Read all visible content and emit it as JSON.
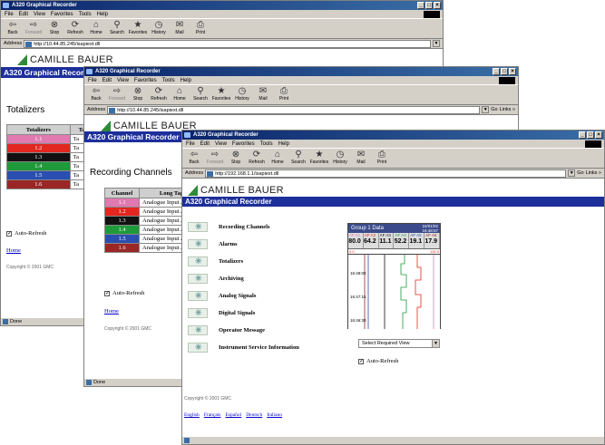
{
  "app": {
    "window_title": "A320 Graphical Recorder",
    "menus": [
      "File",
      "Edit",
      "View",
      "Favorites",
      "Tools",
      "Help"
    ],
    "toolbar": [
      {
        "label": "Back",
        "icon": "back-arrow-icon",
        "glyph": "⇦"
      },
      {
        "label": "Forward",
        "icon": "forward-arrow-icon",
        "glyph": "⇨",
        "disabled": true
      },
      {
        "label": "Stop",
        "icon": "stop-icon",
        "glyph": "⊗"
      },
      {
        "label": "Refresh",
        "icon": "refresh-icon",
        "glyph": "⟳"
      },
      {
        "label": "Home",
        "icon": "home-icon",
        "glyph": "⌂"
      },
      {
        "label": "Search",
        "icon": "search-icon",
        "glyph": "⚲"
      },
      {
        "label": "Favorites",
        "icon": "favorites-icon",
        "glyph": "★"
      },
      {
        "label": "History",
        "icon": "history-icon",
        "glyph": "◷"
      },
      {
        "label": "Mail",
        "icon": "mail-icon",
        "glyph": "✉"
      },
      {
        "label": "Print",
        "icon": "print-icon",
        "glyph": "⎙"
      }
    ],
    "address_label": "Address",
    "go_label": "Go",
    "links_label": "Links »",
    "status_done": "Done"
  },
  "windows": {
    "w1": {
      "url": "http://10.44.85.245/isapiext.dll",
      "brand": "CAMILLE BAUER",
      "banner": "A320 Graphical Recorder",
      "heading": "Totalizers",
      "col1": "Totalizers",
      "col2": "Tag",
      "rows": [
        {
          "id": "1.1",
          "color": "#e07ab0",
          "tag": "Ta"
        },
        {
          "id": "1.2",
          "color": "#e3261f",
          "tag": "Ta"
        },
        {
          "id": "1.3",
          "color": "#111111",
          "tag": "Ta"
        },
        {
          "id": "1.4",
          "color": "#1f9a3a",
          "tag": "Ta"
        },
        {
          "id": "1.5",
          "color": "#2a4fb0",
          "tag": "Ta"
        },
        {
          "id": "1.6",
          "color": "#9a2626",
          "tag": "Ta"
        }
      ],
      "auto_refresh": "Auto-Refresh",
      "home_link": "Home",
      "copyright": "Copyright © 2001 GMC"
    },
    "w2": {
      "url": "http://10.44.85.245/isapiext.dll",
      "brand": "CAMILLE BAUER",
      "banner": "A320 Graphical Recorder",
      "heading": "Recording Channels",
      "col1": "Channel",
      "col2": "Long Tag",
      "rows": [
        {
          "id": "1.1",
          "color": "#e07ab0",
          "tag": "Analogue Input A"
        },
        {
          "id": "1.2",
          "color": "#e3261f",
          "tag": "Analogue Input A"
        },
        {
          "id": "1.3",
          "color": "#111111",
          "tag": "Analogue Input A"
        },
        {
          "id": "1.4",
          "color": "#1f9a3a",
          "tag": "Analogue Input A"
        },
        {
          "id": "1.5",
          "color": "#2a4fb0",
          "tag": "Analogue Input A"
        },
        {
          "id": "1.6",
          "color": "#9a2626",
          "tag": "Analogue Input A"
        }
      ],
      "auto_refresh": "Auto-Refresh",
      "home_link": "Home",
      "copyright": "Copyright © 2001 GMC"
    },
    "w3": {
      "url": "http://192.168.1.1/isapiext.dll",
      "brand": "CAMILLE BAUER",
      "banner": "A320 Graphical Recorder",
      "menu": [
        "Recording Channels",
        "Alarms",
        "Totalizers",
        "Archiving",
        "Analog Signals",
        "Digital Signals",
        "Operator Message",
        "Instrument Service Information"
      ],
      "copyright": "Copyright © 2001 GMC",
      "languages": [
        "English",
        "Français",
        "Español",
        "Deutsch",
        "Italiano"
      ],
      "recorder": {
        "title": "Group 1 Data",
        "date": "24/01/02",
        "time": "16:48:57",
        "channels": [
          {
            "tag": "AF A1",
            "value": "80.0",
            "color": "#e07ab0"
          },
          {
            "tag": "AF A2",
            "value": "64.2",
            "color": "#e3261f"
          },
          {
            "tag": "AF A3",
            "value": "11.1",
            "color": "#111111"
          },
          {
            "tag": "AF A4",
            "value": "52.2",
            "color": "#1f9a3a"
          },
          {
            "tag": "AF A5",
            "value": "19.1",
            "color": "#2a4fb0"
          },
          {
            "tag": "AF A6",
            "value": "17.9",
            "color": "#9a2626"
          }
        ],
        "scale_left": "0.0",
        "scale_right": "100.0",
        "times": [
          "16:48:00",
          "16:47:15",
          "16:46:30"
        ]
      },
      "select_view": "Select Required View",
      "auto_refresh": "Auto-Refresh"
    }
  }
}
